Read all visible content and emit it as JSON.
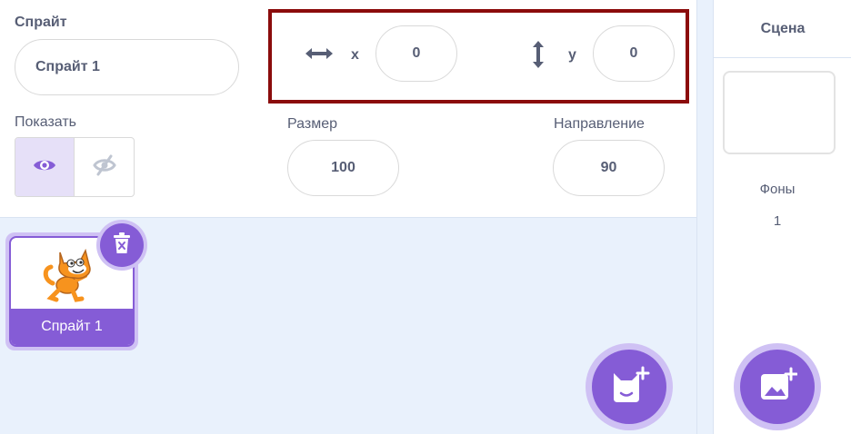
{
  "sprite_info": {
    "sprite_label": "Спрайт",
    "sprite_name": "Спрайт 1",
    "x_label": "x",
    "x_value": "0",
    "y_label": "y",
    "y_value": "0",
    "show_label": "Показать",
    "size_label": "Размер",
    "size_value": "100",
    "direction_label": "Направление",
    "direction_value": "90",
    "visible": true
  },
  "sprite_list": {
    "items": [
      {
        "name": "Спрайт 1",
        "selected": true
      }
    ]
  },
  "stage": {
    "header": "Сцена",
    "backdrops_label": "Фоны",
    "backdrops_count": "1"
  },
  "icons": {
    "x_axis": "horizontal-arrows-icon",
    "y_axis": "vertical-arrows-icon",
    "show": "eye-icon",
    "hide": "eye-slash-icon",
    "delete": "trash-icon",
    "add_sprite": "add-sprite-cat-icon",
    "add_backdrop": "add-backdrop-icon"
  },
  "colors": {
    "accent": "#855cd6",
    "accent_light": "#cfc1f4",
    "highlight_border": "#8b0c0c",
    "text": "#575e75",
    "panel_bg": "#e9f1fc"
  }
}
